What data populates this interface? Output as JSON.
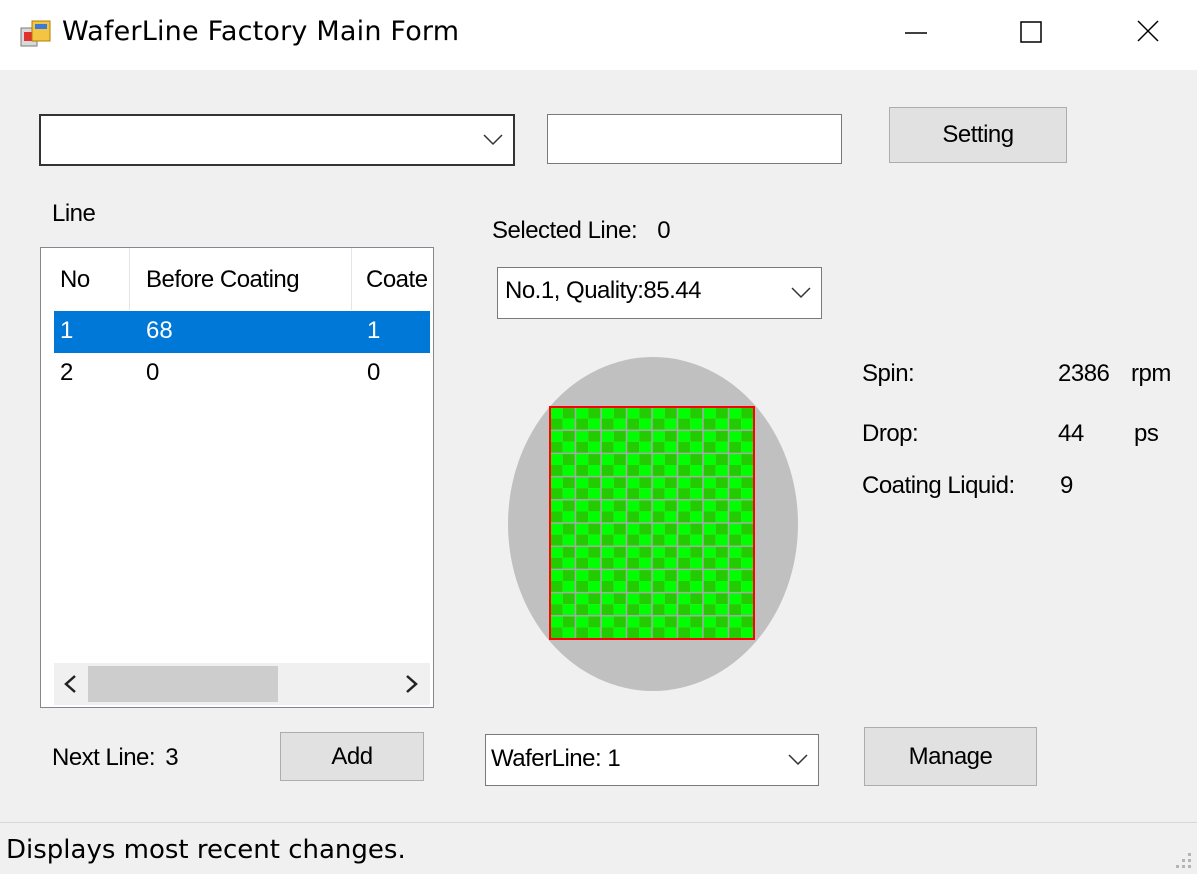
{
  "window": {
    "title": "WaferLine Factory Main Form"
  },
  "top_bar": {
    "combo_value": "",
    "text_value": "",
    "setting_label": "Setting"
  },
  "line_panel": {
    "label": "Line",
    "columns": [
      "No",
      "Before Coating",
      "Coate"
    ],
    "rows": [
      {
        "no": "1",
        "before": "68",
        "coated": "1",
        "selected": true
      },
      {
        "no": "2",
        "before": "0",
        "coated": "0",
        "selected": false
      }
    ],
    "next_line_label": "Next Line:",
    "next_line_value": "3",
    "add_label": "Add"
  },
  "detail": {
    "selected_line_label": "Selected Line:",
    "selected_line_value": "0",
    "wafer_select_value": "No.1, Quality:85.44",
    "waferline_select_value": "WaferLine: 1",
    "manage_label": "Manage"
  },
  "stats": {
    "spin_label": "Spin:",
    "spin_value": "2386",
    "spin_unit": "rpm",
    "drop_label": "Drop:",
    "drop_value": "44",
    "drop_unit": "ps",
    "liquid_label": "Coating Liquid:",
    "liquid_value": "9"
  },
  "wafer_grid": {
    "rows": 10,
    "cols": 8,
    "cell_colors": [
      "#00ff00",
      "#22cc00"
    ],
    "grid_line_color": "#a8a8a8",
    "border_color": "#ff0000",
    "wafer_color": "#c0c0c0"
  },
  "status": {
    "text": "Displays most recent changes."
  }
}
